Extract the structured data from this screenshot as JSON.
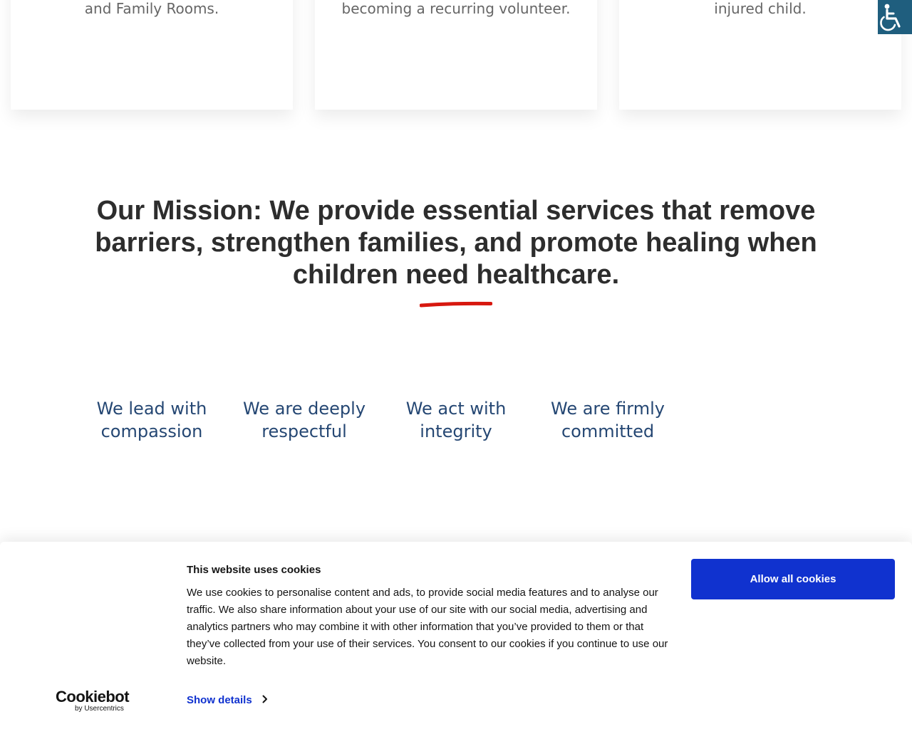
{
  "cards": [
    {
      "text": "and Family Rooms."
    },
    {
      "text": "becoming a recurring volunteer."
    },
    {
      "text": "injured child."
    }
  ],
  "accessibility": {
    "icon": "wheelchair-icon",
    "background": "#1f5e7e"
  },
  "mission": {
    "text": "Our Mission: We provide essential services that remove barriers, strengthen families, and promote healing when children need healthcare.",
    "underline_color": "#d7180f"
  },
  "values": [
    {
      "label": "We lead with compassion"
    },
    {
      "label": "We are deeply respectful"
    },
    {
      "label": "We act with integrity"
    },
    {
      "label": "We are firmly committed"
    }
  ],
  "cookie_banner": {
    "title": "This website uses cookies",
    "body": "We use cookies to personalise content and ads, to provide social media features and to analyse our traffic. We also share information about your use of our site with our social media, advertising and analytics partners who may combine it with other information that you’ve provided to them or that they’ve collected from your use of their services. You consent to our cookies if you continue to use our website.",
    "show_details_label": "Show details",
    "allow_all_label": "Allow all cookies",
    "accent_color": "#1032cf",
    "logo_text": "Cookiebot",
    "logo_subtext": "by Usercentrics"
  }
}
